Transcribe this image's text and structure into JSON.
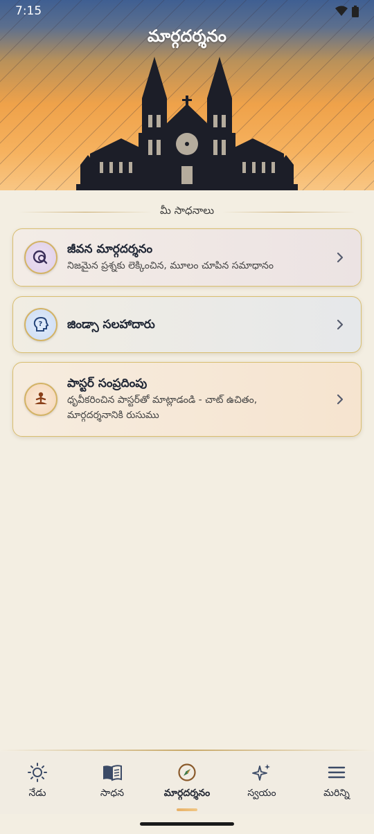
{
  "status_bar": {
    "time": "7:15"
  },
  "header": {
    "title": "మార్గదర్శనం"
  },
  "section": {
    "heading": "మీ సాధనాలు"
  },
  "cards": [
    {
      "title": "జీవన మార్గదర్శనం",
      "subtitle": "నిజమైన ప్రశ్నకు లెక్కించిన, మూలం చూపిన సమాధానం",
      "icon": "search-globe-icon"
    },
    {
      "title": "జిండ్సా సలహాదారు",
      "subtitle": "",
      "icon": "head-question-icon"
    },
    {
      "title": "పాస్టర్ సంప్రదింపు",
      "subtitle_line1": "ధృవీకరించిన పాస్టర్‌తో మాట్లాడండి - చాట్ ఉచితం,",
      "subtitle_line2": "మార్గదర్శనానికి రుసుము",
      "icon": "meditating-person-icon"
    }
  ],
  "nav": [
    {
      "label": "నేడు",
      "icon": "sun-icon",
      "active": false
    },
    {
      "label": "సాధన",
      "icon": "open-book-icon",
      "active": false
    },
    {
      "label": "మార్గదర్శనం",
      "icon": "compass-icon",
      "active": true
    },
    {
      "label": "స్వయం",
      "icon": "sparkles-icon",
      "active": false
    },
    {
      "label": "మరిన్ని",
      "icon": "menu-icon",
      "active": false
    }
  ],
  "colors": {
    "accent_gold": "#d8bd6e",
    "background": "#f3eee2",
    "header_top": "#3f5f92",
    "header_bottom": "#f6b25f"
  }
}
